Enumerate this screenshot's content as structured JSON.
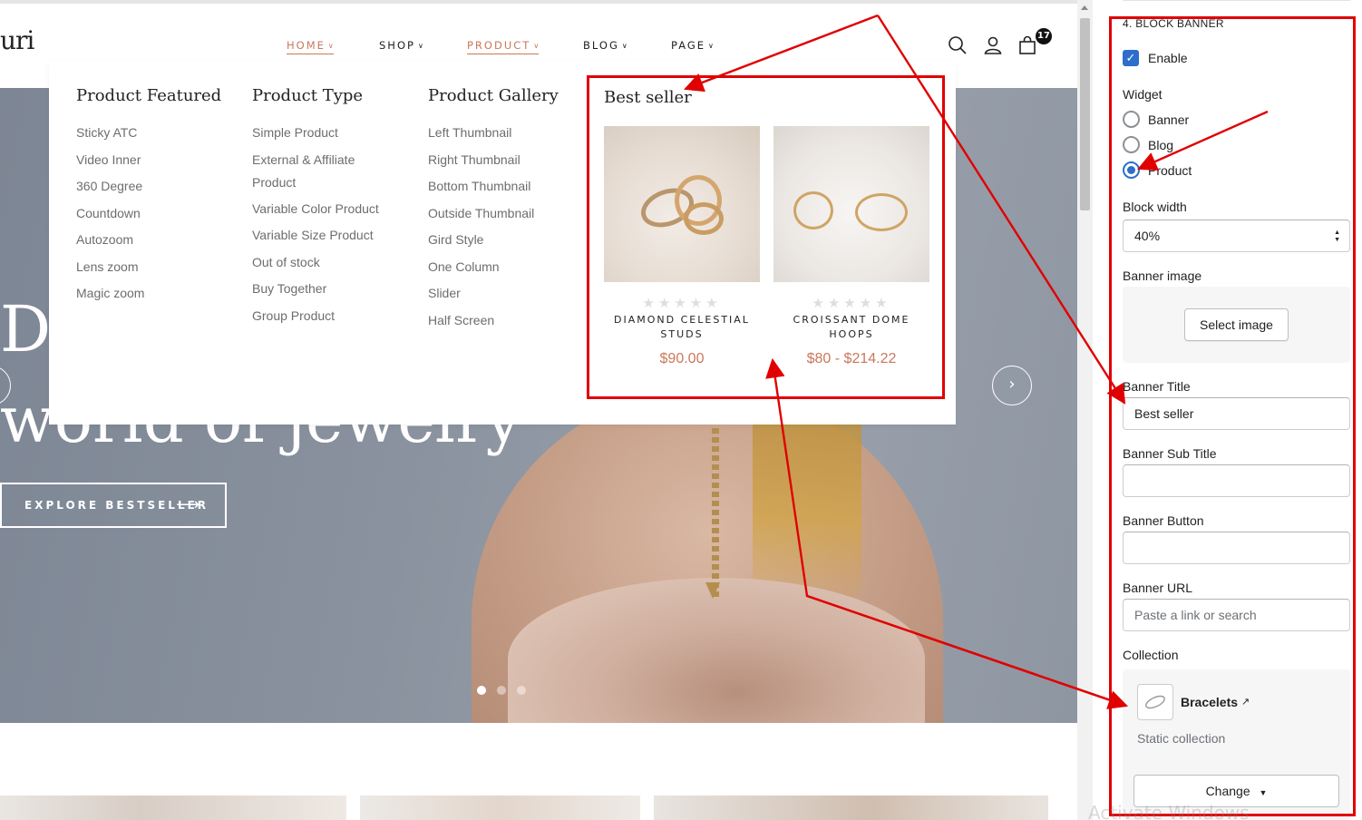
{
  "store": {
    "logo_text": "uri",
    "cart_count": "17",
    "nav": [
      {
        "label": "HOME",
        "active": true
      },
      {
        "label": "SHOP",
        "active": false
      },
      {
        "label": "PRODUCT",
        "active": true
      },
      {
        "label": "BLOG",
        "active": false
      },
      {
        "label": "PAGE",
        "active": false
      }
    ]
  },
  "hero": {
    "title_line1": "D",
    "title_line2": "world of jewelry",
    "cta_label": "EXPLORE BESTSELLER",
    "slide_count": 3,
    "active_slide": 1
  },
  "mega_menu": {
    "columns": [
      {
        "title": "Product Featured",
        "items": [
          "Sticky ATC",
          "Video Inner",
          "360 Degree",
          "Countdown",
          "Autozoom",
          "Lens zoom",
          "Magic zoom"
        ]
      },
      {
        "title": "Product Type",
        "items": [
          "Simple Product",
          "External & Affiliate Product",
          "Variable Color Product",
          "Variable Size Product",
          "Out of stock",
          "Buy Together",
          "Group Product"
        ]
      },
      {
        "title": "Product Gallery",
        "items": [
          "Left Thumbnail",
          "Right Thumbnail",
          "Bottom Thumbnail",
          "Outside Thumbnail",
          "Gird Style",
          "One Column",
          "Slider",
          "Half Screen"
        ]
      }
    ],
    "best_seller": {
      "title": "Best seller",
      "products": [
        {
          "name": "DIAMOND CELESTIAL STUDS",
          "price": "$90.00",
          "rating": 0
        },
        {
          "name": "CROISSANT DOME HOOPS",
          "price": "$80 - $214.22",
          "rating": 0
        }
      ]
    }
  },
  "panel": {
    "section_title": "4. BLOCK BANNER",
    "enable_label": "Enable",
    "enable_checked": true,
    "widget_label": "Widget",
    "widget_options": [
      "Banner",
      "Blog",
      "Product"
    ],
    "widget_selected": "Product",
    "block_width_label": "Block width",
    "block_width_value": "40%",
    "banner_image_label": "Banner image",
    "select_image_label": "Select image",
    "banner_title_label": "Banner Title",
    "banner_title_value": "Best seller",
    "banner_subtitle_label": "Banner Sub Title",
    "banner_subtitle_value": "",
    "banner_button_label": "Banner Button",
    "banner_button_value": "",
    "banner_url_label": "Banner URL",
    "banner_url_placeholder": "Paste a link or search",
    "collection_label": "Collection",
    "collection_name": "Bracelets",
    "collection_type": "Static collection",
    "change_label": "Change"
  },
  "watermark": "Activate Windows",
  "colors": {
    "accent": "#c9785b",
    "annotation_red": "#e00000",
    "shopify_blue": "#2c6ecb"
  }
}
